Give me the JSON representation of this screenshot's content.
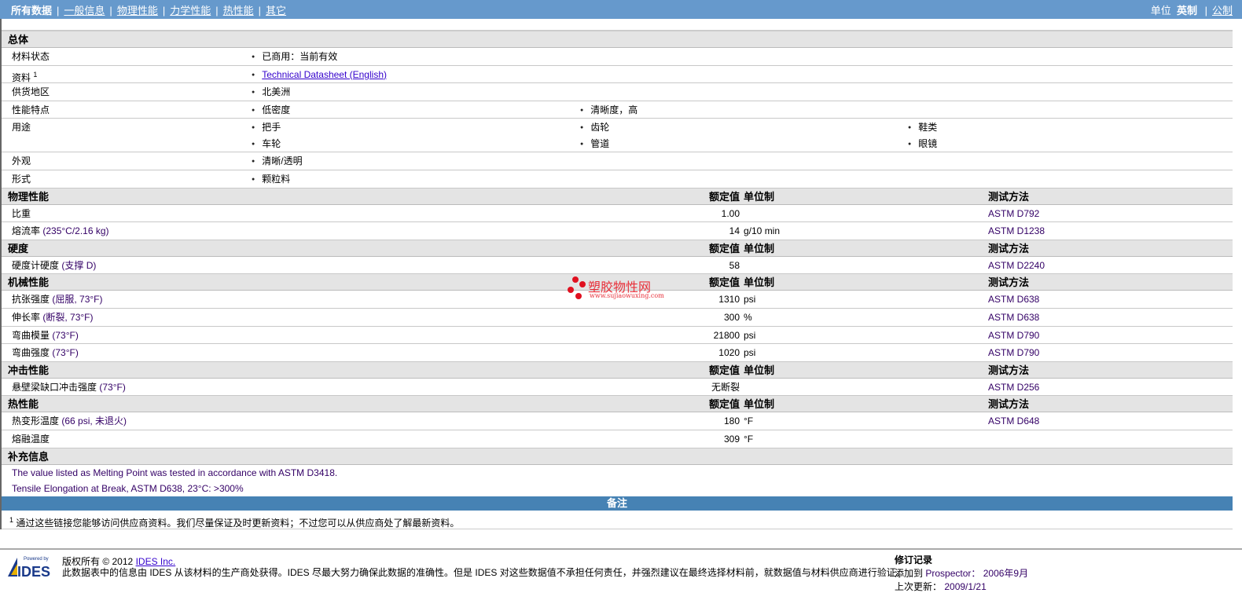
{
  "nav": {
    "tabs": [
      {
        "label": "所有数据",
        "active": true
      },
      {
        "label": "一般信息"
      },
      {
        "label": "物理性能"
      },
      {
        "label": "力学性能"
      },
      {
        "label": "热性能"
      },
      {
        "label": "其它"
      }
    ],
    "units_label": "单位",
    "units_active": "英制",
    "units_other": "公制"
  },
  "general": {
    "title": "总体",
    "rows": [
      {
        "label": "材料状态",
        "items": [
          "已商用：当前有效"
        ]
      },
      {
        "label": "资料",
        "sup": "1",
        "link": "Technical Datasheet (English)"
      },
      {
        "label": "供货地区",
        "items": [
          "北美洲"
        ]
      },
      {
        "label": "性能特点",
        "items": [
          "低密度",
          "清晰度，高"
        ]
      },
      {
        "label": "用途",
        "items": [
          "把手",
          "齿轮",
          "鞋类",
          "车轮",
          "管道",
          "眼镜"
        ]
      },
      {
        "label": "外观",
        "items": [
          "清晰/透明"
        ]
      },
      {
        "label": "形式",
        "items": [
          "颗粒料"
        ]
      }
    ]
  },
  "col_headers": {
    "value": "额定值",
    "unit": "单位制",
    "test": "测试方法"
  },
  "sections": [
    {
      "title": "物理性能",
      "rows": [
        {
          "label": "比重",
          "value": "1.00",
          "unit": "",
          "test": "ASTM D792"
        },
        {
          "label": "熔流率",
          "cond": "(235°C/2.16 kg)",
          "value": "14",
          "unit": "g/10 min",
          "test": "ASTM D1238"
        }
      ]
    },
    {
      "title": "硬度",
      "rows": [
        {
          "label": "硬度计硬度",
          "cond": "(支撑  D)",
          "value": "58",
          "unit": "",
          "test": "ASTM D2240"
        }
      ]
    },
    {
      "title": "机械性能",
      "rows": [
        {
          "label": "抗张强度",
          "cond": "(屈服, 73°F)",
          "value": "1310",
          "unit": "psi",
          "test": "ASTM D638"
        },
        {
          "label": "伸长率",
          "cond": "(断裂, 73°F)",
          "value": "300",
          "unit": "%",
          "test": "ASTM D638"
        },
        {
          "label": "弯曲模量",
          "cond": "(73°F)",
          "value": "21800",
          "unit": "psi",
          "test": "ASTM D790"
        },
        {
          "label": "弯曲强度",
          "cond": "(73°F)",
          "value": "1020",
          "unit": "psi",
          "test": "ASTM D790"
        }
      ]
    },
    {
      "title": "冲击性能",
      "rows": [
        {
          "label": "悬壁梁缺口冲击强度",
          "cond": "(73°F)",
          "value": "无断裂",
          "unit": "",
          "test": "ASTM D256"
        }
      ]
    },
    {
      "title": "热性能",
      "rows": [
        {
          "label": "热变形温度",
          "cond": "(66 psi, 未退火)",
          "value": "180",
          "unit": "°F",
          "test": "ASTM D648"
        },
        {
          "label": "熔融温度",
          "value": "309",
          "unit": "°F",
          "test": ""
        }
      ]
    }
  ],
  "supplement": {
    "title": "补充信息",
    "notes": [
      "The value listed as Melting Point was tested in accordance with ASTM D3418.",
      "Tensile Elongation at Break, ASTM D638, 23°C: >300%"
    ]
  },
  "remarks": {
    "title": "备注",
    "footnote_num": "1",
    "footnote": "通过这些链接您能够访问供应商资料。我们尽量保证及时更新资料；不过您可以从供应商处了解最新资料。"
  },
  "watermark": {
    "name": "塑胶物性网",
    "url": "www.sujiaowuxing.com"
  },
  "footer": {
    "logo_text": "Powered by IDES",
    "copyright": "版权所有  © 2012",
    "company_link": "IDES Inc.",
    "disclaimer": "此数据表中的信息由  IDES 从该材料的生产商处获得。IDES 尽最大努力确保此数据的准确性。但是  IDES 对这些数据值不承担任何责任，并强烈建议在最终选择材料前，就数据值与材料供应商进行验证。",
    "revision_title": "修订记录",
    "added_label": "添加到",
    "added_app": "Prospector：",
    "added_date": "2006年9月",
    "updated_label": "上次更新：",
    "updated_date": "2009/1/21"
  }
}
